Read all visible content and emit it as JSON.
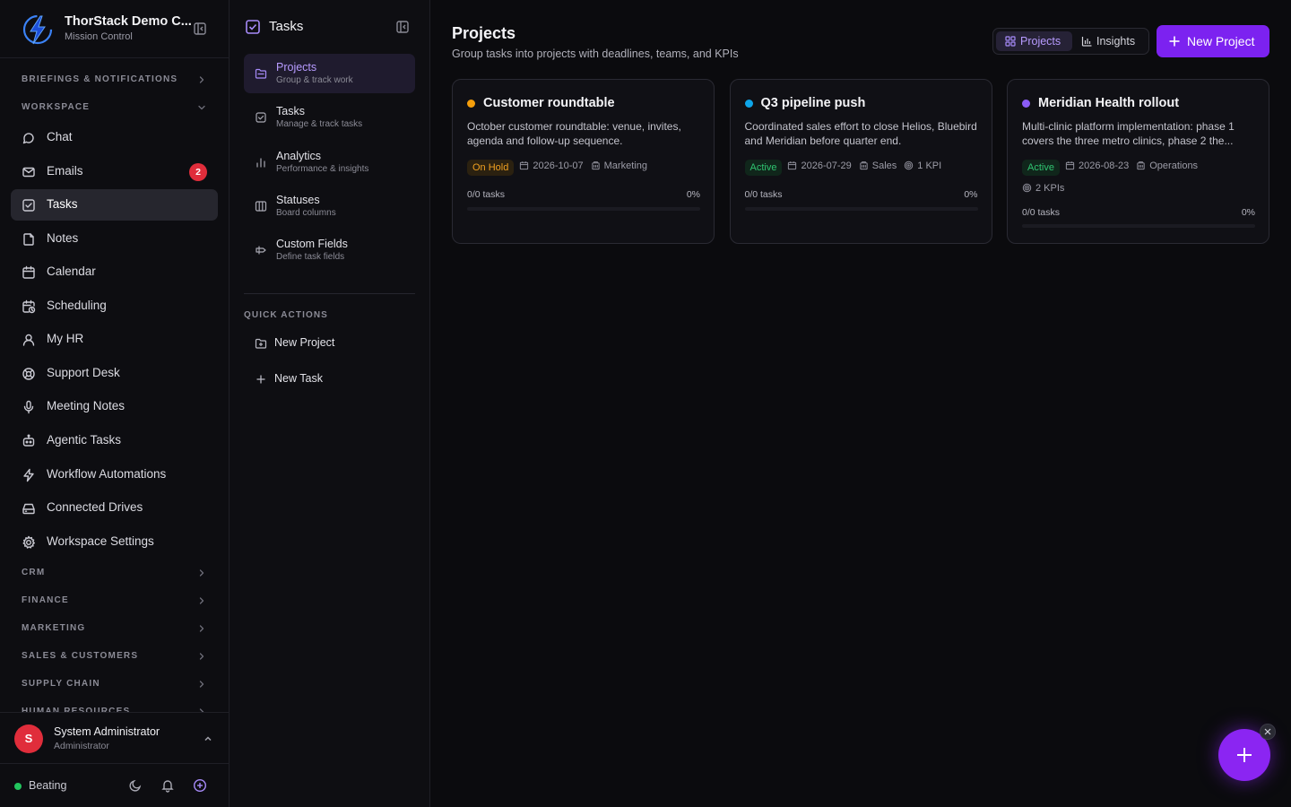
{
  "brand": {
    "name": "ThorStack Demo C...",
    "subtitle": "Mission Control"
  },
  "sidebar": {
    "sections_top": [
      {
        "label": "BRIEFINGS & NOTIFICATIONS"
      },
      {
        "label": "WORKSPACE"
      }
    ],
    "items": [
      {
        "label": "Chat",
        "icon": "chat-bubble-icon"
      },
      {
        "label": "Emails",
        "icon": "mail-icon",
        "badge": "2"
      },
      {
        "label": "Tasks",
        "icon": "check-square-icon",
        "active": true
      },
      {
        "label": "Notes",
        "icon": "note-icon"
      },
      {
        "label": "Calendar",
        "icon": "calendar-icon"
      },
      {
        "label": "Scheduling",
        "icon": "calendar-clock-icon"
      },
      {
        "label": "My HR",
        "icon": "user-icon"
      },
      {
        "label": "Support Desk",
        "icon": "lifebuoy-icon"
      },
      {
        "label": "Meeting Notes",
        "icon": "microphone-icon"
      },
      {
        "label": "Agentic Tasks",
        "icon": "robot-icon"
      },
      {
        "label": "Workflow Automations",
        "icon": "bolt-icon"
      },
      {
        "label": "Connected Drives",
        "icon": "hard-drive-icon"
      },
      {
        "label": "Workspace Settings",
        "icon": "gear-icon"
      }
    ],
    "sections_bottom": [
      {
        "label": "CRM"
      },
      {
        "label": "FINANCE"
      },
      {
        "label": "MARKETING"
      },
      {
        "label": "SALES & CUSTOMERS"
      },
      {
        "label": "SUPPLY CHAIN"
      },
      {
        "label": "HUMAN RESOURCES"
      }
    ],
    "user": {
      "initial": "S",
      "name": "System Administrator",
      "role": "Administrator"
    },
    "status": {
      "label": "Beating"
    }
  },
  "subnav": {
    "title": "Tasks",
    "items": [
      {
        "title": "Projects",
        "desc": "Group & track work",
        "active": true
      },
      {
        "title": "Tasks",
        "desc": "Manage & track tasks"
      },
      {
        "title": "Analytics",
        "desc": "Performance & insights"
      },
      {
        "title": "Statuses",
        "desc": "Board columns"
      },
      {
        "title": "Custom Fields",
        "desc": "Define task fields"
      }
    ],
    "quick_actions_label": "QUICK ACTIONS",
    "quick_actions": [
      {
        "label": "New Project"
      },
      {
        "label": "New Task"
      }
    ]
  },
  "main": {
    "title": "Projects",
    "subtitle": "Group tasks into projects with deadlines, teams, and KPIs",
    "view_toggle": [
      {
        "label": "Projects",
        "active": true
      },
      {
        "label": "Insights"
      }
    ],
    "new_button": "New Project",
    "projects": [
      {
        "name": "Customer roundtable",
        "color": "#f59e0b",
        "description": "October customer roundtable: venue, invites, agenda and follow-up sequence.",
        "status": "On Hold",
        "date": "2026-10-07",
        "team": "Marketing",
        "kpis": "",
        "tasks": "0/0 tasks",
        "percent": "0%",
        "progress": 0
      },
      {
        "name": "Q3 pipeline push",
        "color": "#0ea5e9",
        "description": "Coordinated sales effort to close Helios, Bluebird and Meridian before quarter end.",
        "status": "Active",
        "date": "2026-07-29",
        "team": "Sales",
        "kpis": "1 KPI",
        "tasks": "0/0 tasks",
        "percent": "0%",
        "progress": 0
      },
      {
        "name": "Meridian Health rollout",
        "color": "#8b5cf6",
        "description": "Multi-clinic platform implementation: phase 1 covers the three metro clinics, phase 2 the...",
        "status": "Active",
        "date": "2026-08-23",
        "team": "Operations",
        "kpis": "2 KPIs",
        "tasks": "0/0 tasks",
        "percent": "0%",
        "progress": 0
      }
    ]
  },
  "colors": {
    "accent": "#7c22f0",
    "danger": "#e02d3b",
    "online": "#22c55e"
  }
}
